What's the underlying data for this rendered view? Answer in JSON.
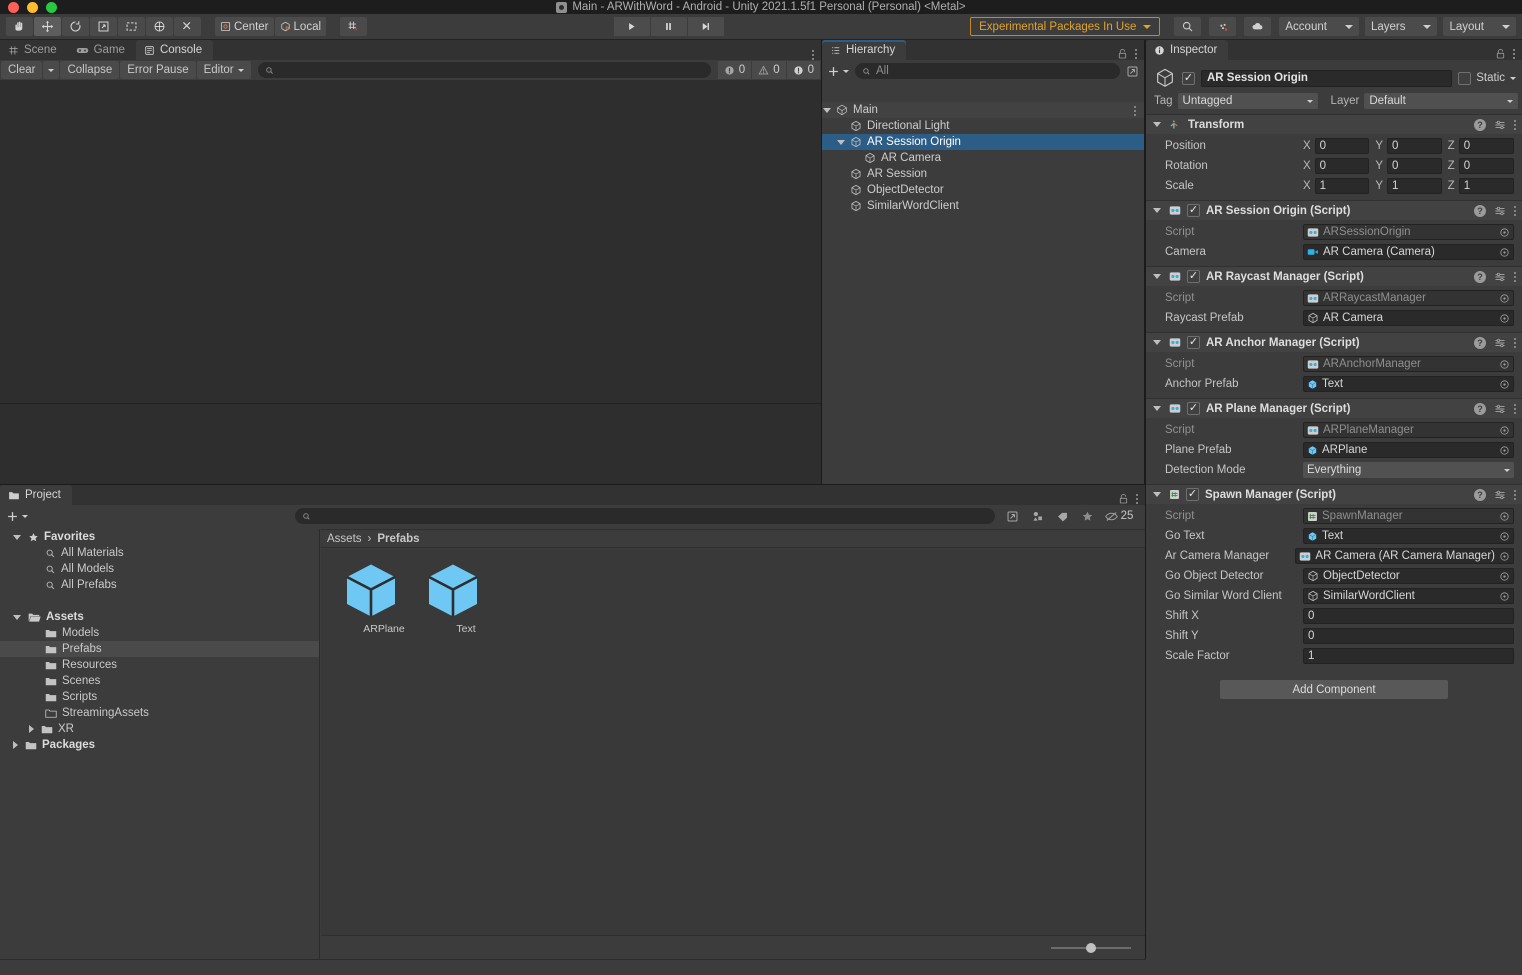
{
  "window": {
    "title": "Main - ARWithWord - Android - Unity 2021.1.5f1 Personal (Personal) <Metal>"
  },
  "toolbar": {
    "tools": [
      {
        "name": "hand-tool",
        "icon": "hand-icon"
      },
      {
        "name": "move-tool",
        "icon": "move-icon"
      },
      {
        "name": "rotate-tool",
        "icon": "rotate-icon"
      },
      {
        "name": "scale-tool",
        "icon": "scale-icon"
      },
      {
        "name": "rect-tool",
        "icon": "rect-icon"
      },
      {
        "name": "transform-tool",
        "icon": "transform-icon"
      },
      {
        "name": "custom-tool",
        "icon": "wrench-icon"
      }
    ],
    "pivot_mode": "Center",
    "pivot_rotation": "Local",
    "grid_label": "",
    "play": "play-icon",
    "pause": "pause-icon",
    "step": "step-icon",
    "experimental_badge": "Experimental Packages In Use",
    "search_icon": "search-icon",
    "collab_icon": "cloud-icon",
    "account": "Account",
    "layers": "Layers",
    "layout": "Layout"
  },
  "console": {
    "tabs": [
      {
        "label": "Scene",
        "icon": "grid-icon",
        "active": false
      },
      {
        "label": "Game",
        "icon": "gamepad-icon",
        "active": false
      },
      {
        "label": "Console",
        "icon": "console-icon",
        "active": true
      }
    ],
    "clear": "Clear",
    "collapse": "Collapse",
    "error_pause": "Error Pause",
    "editor": "Editor",
    "search_placeholder": "",
    "counts": {
      "log": "0",
      "warning": "0",
      "error": "0"
    }
  },
  "hierarchy": {
    "tab": "Hierarchy",
    "search_placeholder": "All",
    "items": [
      {
        "label": "Main",
        "depth": 0,
        "type": "scene",
        "expanded": true,
        "selected": false
      },
      {
        "label": "Directional Light",
        "depth": 1,
        "type": "go",
        "expanded": null,
        "selected": false
      },
      {
        "label": "AR Session Origin",
        "depth": 1,
        "type": "go",
        "expanded": true,
        "selected": true
      },
      {
        "label": "AR Camera",
        "depth": 2,
        "type": "go",
        "expanded": null,
        "selected": false
      },
      {
        "label": "AR Session",
        "depth": 1,
        "type": "go",
        "expanded": null,
        "selected": false
      },
      {
        "label": "ObjectDetector",
        "depth": 1,
        "type": "go",
        "expanded": null,
        "selected": false
      },
      {
        "label": "SimilarWordClient",
        "depth": 1,
        "type": "go",
        "expanded": null,
        "selected": false
      }
    ]
  },
  "inspector": {
    "tab": "Inspector",
    "object_name": "AR Session Origin",
    "enabled": true,
    "static_label": "Static",
    "tag_label": "Tag",
    "tag_value": "Untagged",
    "layer_label": "Layer",
    "layer_value": "Default",
    "components": [
      {
        "title": "Transform",
        "icon": "transform-icon",
        "has_checkbox": false,
        "rows": [
          {
            "kind": "vector3",
            "label": "Position",
            "x": "0",
            "y": "0",
            "z": "0"
          },
          {
            "kind": "vector3",
            "label": "Rotation",
            "x": "0",
            "y": "0",
            "z": "0"
          },
          {
            "kind": "vector3",
            "label": "Scale",
            "x": "1",
            "y": "1",
            "z": "1"
          }
        ]
      },
      {
        "title": "AR Session Origin (Script)",
        "icon": "script-icon",
        "has_checkbox": true,
        "enabled": true,
        "rows": [
          {
            "kind": "object",
            "label": "Script",
            "value": "ARSessionOrigin",
            "icon": "script-icon",
            "dim": true
          },
          {
            "kind": "object",
            "label": "Camera",
            "value": "AR Camera (Camera)",
            "icon": "camera-icon",
            "dim": false
          }
        ]
      },
      {
        "title": "AR Raycast Manager (Script)",
        "icon": "script-icon",
        "has_checkbox": true,
        "enabled": true,
        "rows": [
          {
            "kind": "object",
            "label": "Script",
            "value": "ARRaycastManager",
            "icon": "script-icon",
            "dim": true
          },
          {
            "kind": "object",
            "label": "Raycast Prefab",
            "value": "AR Camera",
            "icon": "gameobject-icon",
            "dim": false
          }
        ]
      },
      {
        "title": "AR Anchor Manager (Script)",
        "icon": "script-icon",
        "has_checkbox": true,
        "enabled": true,
        "rows": [
          {
            "kind": "object",
            "label": "Script",
            "value": "ARAnchorManager",
            "icon": "script-icon",
            "dim": true
          },
          {
            "kind": "object",
            "label": "Anchor Prefab",
            "value": "Text",
            "icon": "prefab-icon",
            "dim": false
          }
        ]
      },
      {
        "title": "AR Plane Manager (Script)",
        "icon": "script-icon",
        "has_checkbox": true,
        "enabled": true,
        "rows": [
          {
            "kind": "object",
            "label": "Script",
            "value": "ARPlaneManager",
            "icon": "script-icon",
            "dim": true
          },
          {
            "kind": "object",
            "label": "Plane Prefab",
            "value": "ARPlane",
            "icon": "prefab-icon",
            "dim": false
          },
          {
            "kind": "dropdown",
            "label": "Detection Mode",
            "value": "Everything"
          }
        ]
      },
      {
        "title": "Spawn Manager (Script)",
        "icon": "cs-script-icon",
        "has_checkbox": true,
        "enabled": true,
        "rows": [
          {
            "kind": "object",
            "label": "Script",
            "value": "SpawnManager",
            "icon": "cs-script-icon",
            "dim": true
          },
          {
            "kind": "object",
            "label": "Go Text",
            "value": "Text",
            "icon": "prefab-icon",
            "dim": false
          },
          {
            "kind": "object",
            "label": "Ar Camera Manager",
            "value": "AR Camera (AR Camera Manager)",
            "icon": "script-icon",
            "dim": false
          },
          {
            "kind": "object",
            "label": "Go Object Detector",
            "value": "ObjectDetector",
            "icon": "gameobject-icon",
            "dim": false
          },
          {
            "kind": "object",
            "label": "Go Similar Word Client",
            "value": "SimilarWordClient",
            "icon": "gameobject-icon",
            "dim": false
          },
          {
            "kind": "number",
            "label": "Shift X",
            "value": "0"
          },
          {
            "kind": "number",
            "label": "Shift Y",
            "value": "0"
          },
          {
            "kind": "number",
            "label": "Scale Factor",
            "value": "1"
          }
        ]
      }
    ],
    "add_component": "Add Component"
  },
  "project": {
    "tab": "Project",
    "search_placeholder": "",
    "tree": [
      {
        "label": "Favorites",
        "depth": 0,
        "icon": "star-icon",
        "expanded": true,
        "bold": true,
        "selected": false
      },
      {
        "label": "All Materials",
        "depth": 1,
        "icon": "search-icon",
        "expanded": null,
        "bold": false,
        "selected": false
      },
      {
        "label": "All Models",
        "depth": 1,
        "icon": "search-icon",
        "expanded": null,
        "bold": false,
        "selected": false
      },
      {
        "label": "All Prefabs",
        "depth": 1,
        "icon": "search-icon",
        "expanded": null,
        "bold": false,
        "selected": false
      },
      {
        "label": "",
        "depth": 0,
        "icon": "spacer",
        "expanded": null,
        "bold": false,
        "selected": false
      },
      {
        "label": "Assets",
        "depth": 0,
        "icon": "assets-folder-icon",
        "expanded": true,
        "bold": true,
        "selected": false
      },
      {
        "label": "Models",
        "depth": 1,
        "icon": "folder-icon",
        "expanded": null,
        "bold": false,
        "selected": false
      },
      {
        "label": "Prefabs",
        "depth": 1,
        "icon": "folder-icon",
        "expanded": null,
        "bold": false,
        "selected": true
      },
      {
        "label": "Resources",
        "depth": 1,
        "icon": "folder-icon",
        "expanded": null,
        "bold": false,
        "selected": false
      },
      {
        "label": "Scenes",
        "depth": 1,
        "icon": "folder-icon",
        "expanded": null,
        "bold": false,
        "selected": false
      },
      {
        "label": "Scripts",
        "depth": 1,
        "icon": "folder-icon",
        "expanded": null,
        "bold": false,
        "selected": false
      },
      {
        "label": "StreamingAssets",
        "depth": 1,
        "icon": "folder-open-icon",
        "expanded": null,
        "bold": false,
        "selected": false
      },
      {
        "label": "XR",
        "depth": 1,
        "icon": "folder-icon",
        "expanded": false,
        "bold": false,
        "selected": false
      },
      {
        "label": "Packages",
        "depth": 0,
        "icon": "folder-icon",
        "expanded": false,
        "bold": true,
        "selected": false
      }
    ],
    "breadcrumb": [
      "Assets",
      "Prefabs"
    ],
    "assets": [
      {
        "name": "ARPlane",
        "icon": "prefab-cube-icon"
      },
      {
        "name": "Text",
        "icon": "prefab-cube-icon"
      }
    ],
    "visible_count": "25"
  },
  "colors": {
    "accent_selection": "#2c5d87",
    "panel_bg": "#3c3c3c",
    "toolbar_bg": "#3c3c3c",
    "field_bg": "#2a2a2a",
    "prefab_blue": "#6fc8f3",
    "warning_orange": "#e2a32a"
  }
}
